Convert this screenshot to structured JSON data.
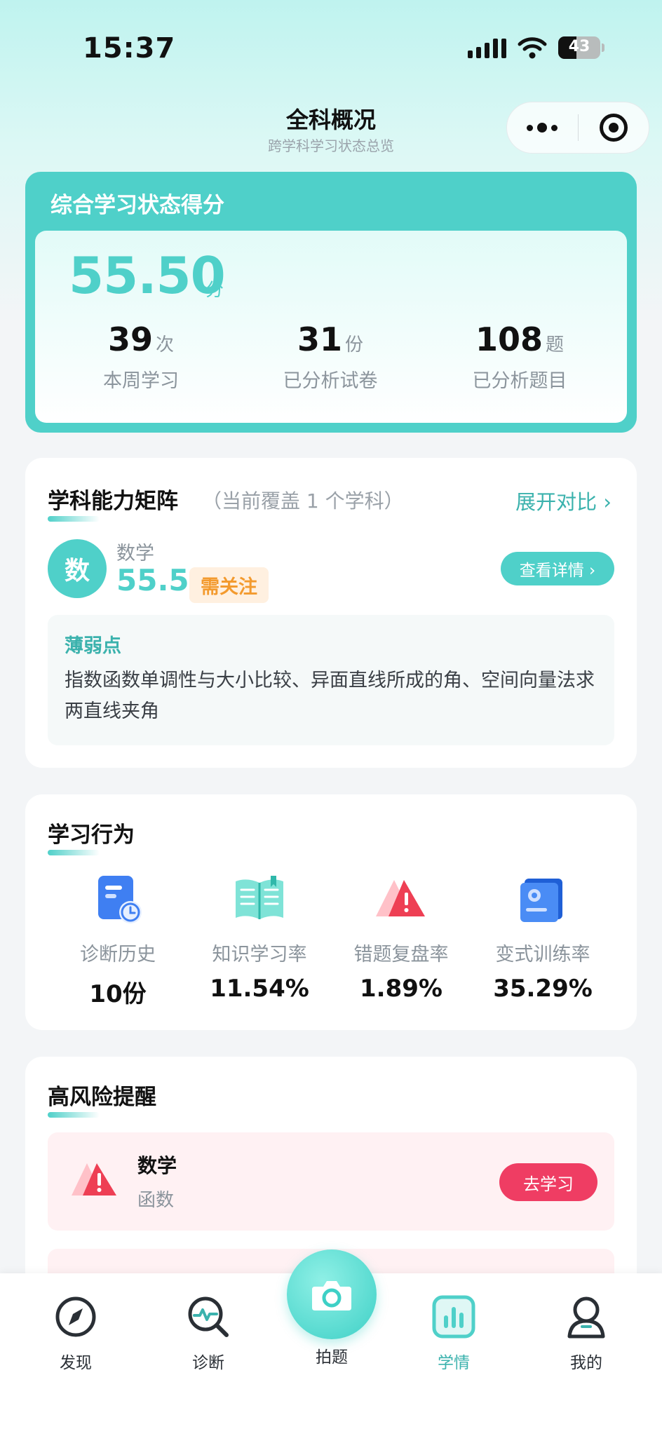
{
  "status_bar": {
    "time": "15:37",
    "battery": "43",
    "battery_level": 0.43
  },
  "header": {
    "title": "全科概况",
    "subtitle": "跨学科学习状态总览"
  },
  "score_card": {
    "title": "综合学习状态得分",
    "score": "55.50",
    "score_unit": "分",
    "stats": [
      {
        "value": "39",
        "unit": "次",
        "label": "本周学习"
      },
      {
        "value": "31",
        "unit": "份",
        "label": "已分析试卷"
      },
      {
        "value": "108",
        "unit": "题",
        "label": "已分析题目"
      }
    ]
  },
  "matrix": {
    "title": "学科能力矩阵",
    "subtitle": "（当前覆盖 1 个学科）",
    "expand_label": "展开对比 ›",
    "subject": {
      "badge_char": "数",
      "name": "数学",
      "score": "55.5",
      "status": "需关注",
      "detail_label": "查看详情 ›"
    },
    "weak": {
      "title": "薄弱点",
      "text": "指数函数单调性与大小比较、异面直线所成的角、空间向量法求两直线夹角"
    }
  },
  "behavior": {
    "title": "学习行为",
    "items": [
      {
        "label": "诊断历史",
        "value": "10份",
        "icon": "history-doc-icon"
      },
      {
        "label": "知识学习率",
        "value": "11.54%",
        "icon": "open-book-icon"
      },
      {
        "label": "错题复盘率",
        "value": "1.89%",
        "icon": "warning-triangle-icon"
      },
      {
        "label": "变式训练率",
        "value": "35.29%",
        "icon": "folder-gear-icon"
      }
    ]
  },
  "risk": {
    "title": "高风险提醒",
    "items": [
      {
        "subject": "数学",
        "topic": "函数",
        "action": "去学习"
      }
    ]
  },
  "nav": {
    "items": [
      {
        "label": "发现",
        "icon": "compass-icon"
      },
      {
        "label": "诊断",
        "icon": "magnifier-pulse-icon"
      },
      {
        "label": "拍题",
        "icon": "camera-icon"
      },
      {
        "label": "学情",
        "icon": "bar-chart-icon"
      },
      {
        "label": "我的",
        "icon": "person-icon"
      }
    ],
    "active": "学情"
  },
  "colors": {
    "accent": "#4fd0c9",
    "accent_dark": "#3bb2ad",
    "danger": "#ef3d63",
    "warning": "#f39a2e"
  }
}
